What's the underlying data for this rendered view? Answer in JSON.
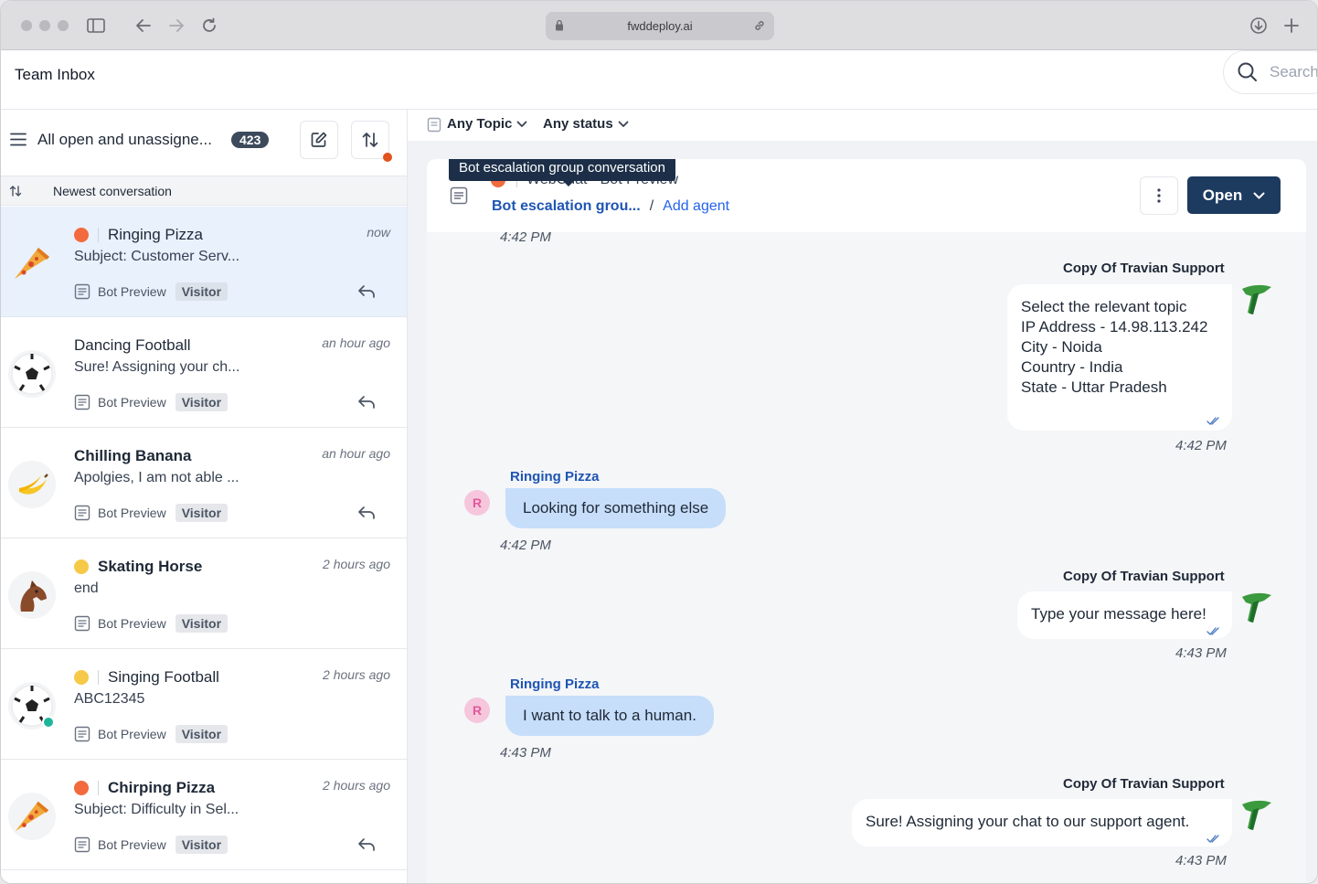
{
  "browser": {
    "url": "fwddeploy.ai"
  },
  "app": {
    "title": "Team Inbox",
    "search_placeholder": "Search"
  },
  "list": {
    "view_title": "All open and unassigne...",
    "count": "423",
    "sort_label": "Newest conversation",
    "conversations": [
      {
        "name": "Ringing Pizza",
        "time": "now",
        "preview": "Subject: Customer Serv...",
        "source": "Bot Preview",
        "tag": "Visitor"
      },
      {
        "name": "Dancing Football",
        "time": "an hour ago",
        "preview": "Sure! Assigning your ch...",
        "source": "Bot Preview",
        "tag": "Visitor"
      },
      {
        "name": "Chilling Banana",
        "time": "an hour ago",
        "preview": "Apolgies, I am not able ...",
        "source": "Bot Preview",
        "tag": "Visitor"
      },
      {
        "name": "Skating Horse",
        "time": "2 hours ago",
        "preview": "end",
        "source": "Bot Preview",
        "tag": "Visitor"
      },
      {
        "name": "Singing Football",
        "time": "2 hours ago",
        "preview": "ABC12345",
        "source": "Bot Preview",
        "tag": "Visitor"
      },
      {
        "name": "Chirping Pizza",
        "time": "2 hours ago",
        "preview": "Subject: Difficulty in Sel...",
        "source": "Bot Preview",
        "tag": "Visitor"
      }
    ]
  },
  "filters": {
    "topic": "Any Topic",
    "status": "Any status"
  },
  "chat": {
    "tooltip": "Bot escalation group conversation",
    "subline": "WebChat - Bot Preview",
    "crumb_group": "Bot escalation grou...",
    "crumb_sep": "/",
    "crumb_agent": "Add agent",
    "open_label": "Open",
    "messages": {
      "t0": "4:42 PM",
      "bot1_sender": "Copy Of Travian Support",
      "bot1_lines": [
        "Select the relevant topic",
        "IP Address - 14.98.113.242",
        "City - Noida",
        "Country - India",
        "State - Uttar Pradesh"
      ],
      "bot1_time": "4:42 PM",
      "user1_sender": "Ringing Pizza",
      "user1_text": "Looking for something else",
      "user1_time": "4:42 PM",
      "user_initial": "R",
      "bot2_sender": "Copy Of Travian Support",
      "bot2_text": "Type your message here!",
      "bot2_time": "4:43 PM",
      "user2_sender": "Ringing Pizza",
      "user2_text": "I want to talk to a human.",
      "user2_time": "4:43 PM",
      "bot3_sender": "Copy Of Travian Support",
      "bot3_text": "Sure! Assigning your chat to our support agent.",
      "bot3_time": "4:43 PM"
    }
  }
}
